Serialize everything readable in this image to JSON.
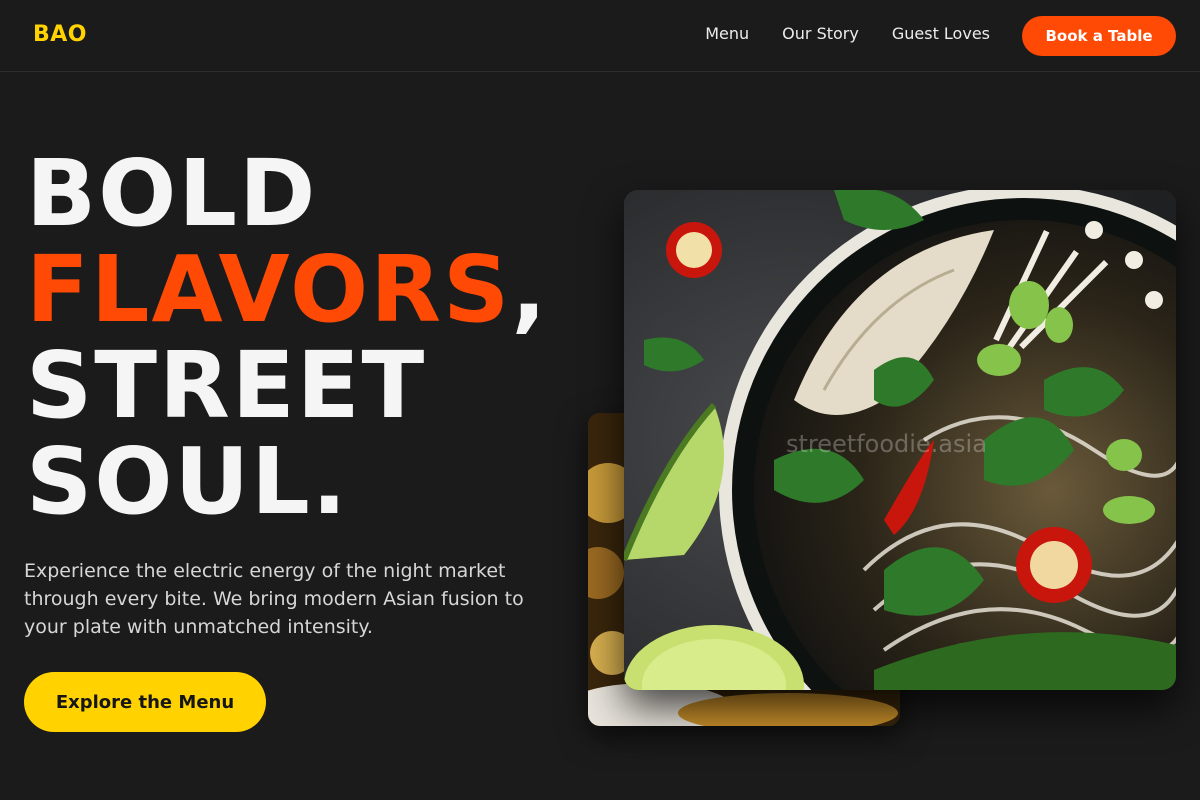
{
  "brand": {
    "logo": "BAO"
  },
  "nav": {
    "items": [
      "Menu",
      "Our Story",
      "Guest Loves"
    ],
    "cta": "Book a Table"
  },
  "hero": {
    "line1": "BOLD",
    "line2_accent": "FLAVORS",
    "line2_rest": ",",
    "line3": "STREET",
    "line4": "SOUL.",
    "subtext": "Experience the electric energy of the night market through every bite. We bring modern Asian fusion to your plate with unmatched intensity.",
    "cta": "Explore the Menu"
  },
  "images": {
    "watermark": "streetfoodie.asia"
  },
  "colors": {
    "background": "#1b1b1c",
    "accent_orange": "#ff4a06",
    "accent_yellow": "#ffd200"
  }
}
